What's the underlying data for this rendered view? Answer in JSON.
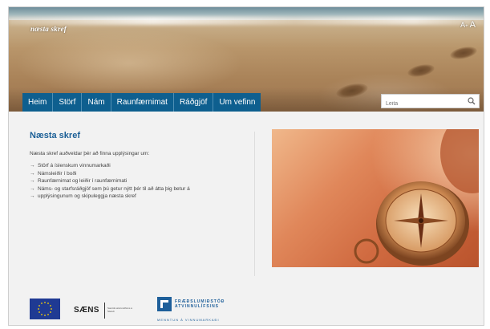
{
  "site": {
    "logo_text": "næsta skref",
    "font_size_small": "A",
    "font_size_large": "A"
  },
  "nav": {
    "items": [
      {
        "label": "Heim"
      },
      {
        "label": "Störf"
      },
      {
        "label": "Nám"
      },
      {
        "label": "Raunfærnimat"
      },
      {
        "label": "Ráðgjöf"
      },
      {
        "label": "Um vefinn"
      }
    ]
  },
  "search": {
    "placeholder": "Leita",
    "icon": "search-icon"
  },
  "main": {
    "title": "Næsta skref",
    "intro": "Næsta skref auðveldar þér að finna upplýsingar um:",
    "bullets": [
      "Störf á íslenskum vinnumarkaði",
      "Námsleiðir í boði",
      "Raunfærnimat og leiðir í raunfærnimati",
      "Náms- og starfsráðgjöf sem þú getur nýtt þér til að átta þig betur á",
      "upplýsingunum og skipuleggja næsta skref"
    ],
    "image": "compass-photo"
  },
  "footer": {
    "logos": {
      "eu": "eu-flag-icon",
      "saens": "SÆNS",
      "saens_sub": "Samtök atvinnulífsins á Íslandi",
      "frae_name_line1": "FRÆÐSLUMIÐSTÖÐ",
      "frae_name_line2": "ATVINNULÍFSINS",
      "frae_tagline": "MENNTUN Á VINNUMARKAÐI"
    }
  },
  "colors": {
    "nav_bg": "#0e5f8f",
    "title": "#1b5f96",
    "eu_blue": "#1f3a93",
    "frae_blue": "#1e5f9a"
  }
}
